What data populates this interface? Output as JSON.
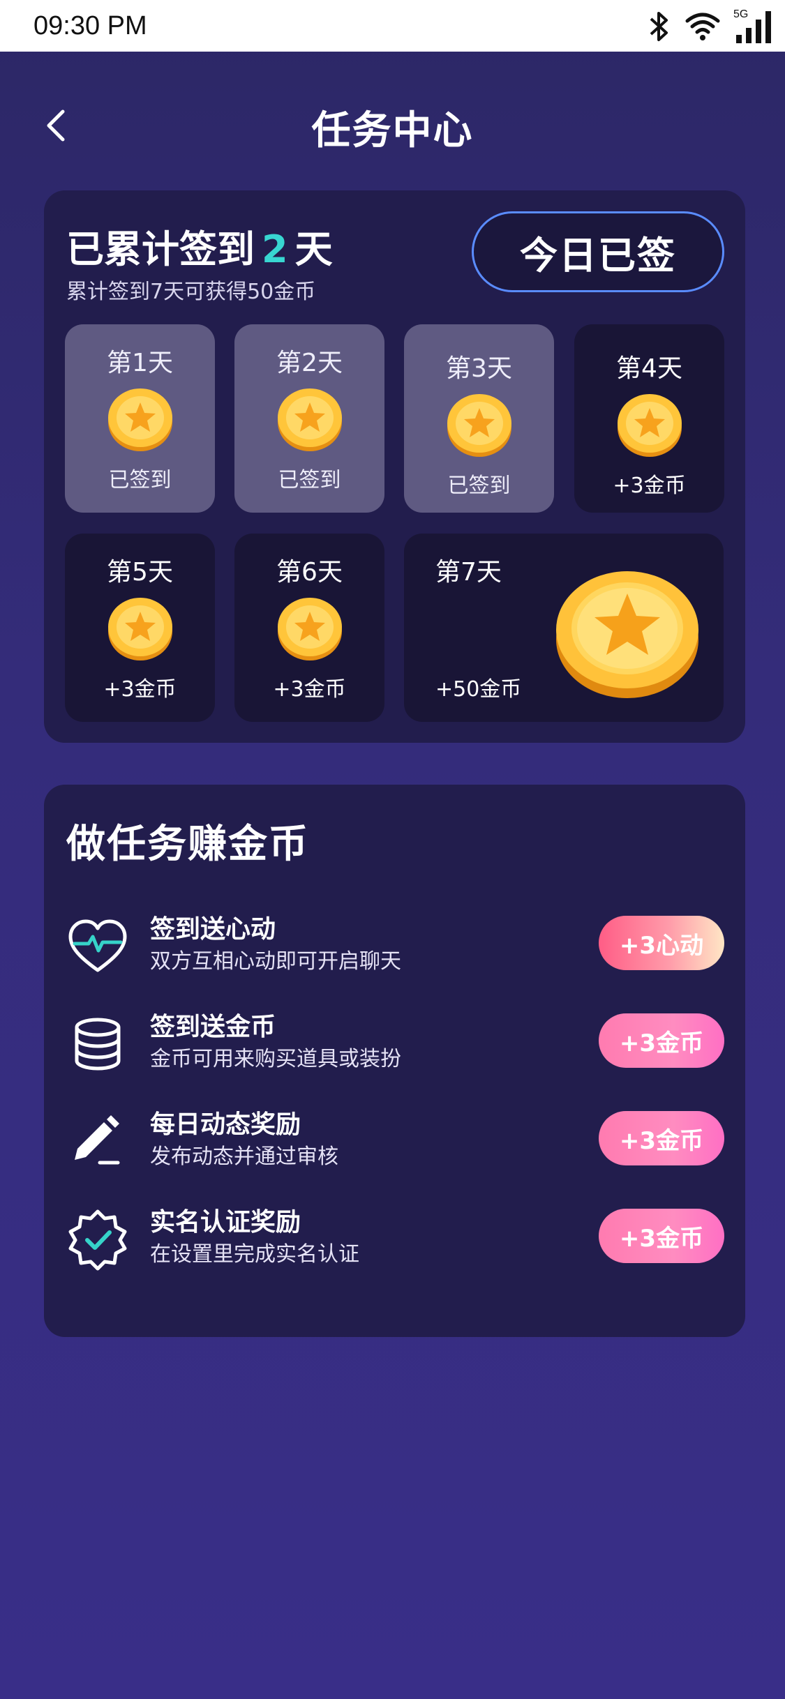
{
  "status_bar": {
    "time": "09:30 PM",
    "network": "5G"
  },
  "header": {
    "title": "任务中心"
  },
  "signin": {
    "summary_prefix": "已累计签到",
    "count": "2",
    "summary_suffix": "天",
    "subtitle": "累计签到7天可获得50金币",
    "button_label": "今日已签",
    "days": [
      {
        "label": "第1天",
        "reward": "已签到",
        "signed": true
      },
      {
        "label": "第2天",
        "reward": "已签到",
        "signed": true
      },
      {
        "label": "第3天",
        "reward": "已签到",
        "signed": true
      },
      {
        "label": "第4天",
        "reward": "+3金币",
        "signed": false
      },
      {
        "label": "第5天",
        "reward": "+3金币",
        "signed": false
      },
      {
        "label": "第6天",
        "reward": "+3金币",
        "signed": false
      },
      {
        "label": "第7天",
        "reward": "+50金币",
        "signed": false
      }
    ]
  },
  "tasks": {
    "title": "做任务赚金币",
    "items": [
      {
        "name": "签到送心动",
        "desc": "双方互相心动即可开启聊天",
        "button": "+3心动",
        "icon": "heart-pulse-icon"
      },
      {
        "name": "签到送金币",
        "desc": "金币可用来购买道具或装扮",
        "button": "+3金币",
        "icon": "coin-stack-icon"
      },
      {
        "name": "每日动态奖励",
        "desc": "发布动态并通过审核",
        "button": "+3金币",
        "icon": "pencil-icon"
      },
      {
        "name": "实名认证奖励",
        "desc": "在设置里完成实名认证",
        "button": "+3金币",
        "icon": "verified-badge-icon"
      }
    ]
  },
  "colors": {
    "accent_count": "#38d6d1",
    "button_border": "#5a8cff",
    "task_button_pink": "#ff7bb0"
  }
}
